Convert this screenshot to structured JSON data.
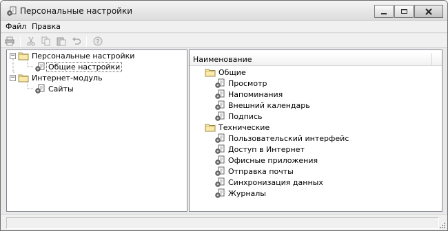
{
  "window": {
    "title": "Персональные настройки",
    "icon": "settings-app-icon",
    "controls": {
      "minimize": "minimize-icon",
      "maximize": "maximize-icon",
      "close": "close-icon"
    }
  },
  "menubar": {
    "items": [
      {
        "label": "Файл"
      },
      {
        "label": "Правка"
      }
    ]
  },
  "toolbar": {
    "buttons": [
      {
        "icon": "print-icon"
      },
      {
        "icon": "cut-icon"
      },
      {
        "icon": "copy-icon"
      },
      {
        "icon": "paste-icon"
      },
      {
        "icon": "undo-icon"
      },
      {
        "icon": "help-icon"
      }
    ]
  },
  "tree": {
    "nodes": [
      {
        "label": "Персональные настройки",
        "icon": "folder-icon",
        "expander": "−"
      },
      {
        "label": "Общие настройки",
        "icon": "settings-item-icon"
      },
      {
        "label": "Интернет-модуль",
        "icon": "folder-icon",
        "expander": "−"
      },
      {
        "label": "Сайты",
        "icon": "settings-item-icon"
      }
    ]
  },
  "list": {
    "column_header": "Наименование",
    "groups": [
      {
        "label": "Общие",
        "icon": "folder-icon",
        "items": [
          "Просмотр",
          "Напоминания",
          "Внешний календарь",
          "Подпись"
        ]
      },
      {
        "label": "Технические",
        "icon": "folder-icon",
        "items": [
          "Пользовательский интерфейс",
          "Доступ в Интернет",
          "Офисные приложения",
          "Отправка почты",
          "Синхронизация данных",
          "Журналы"
        ]
      }
    ]
  },
  "colors": {
    "window_bg": "#e9e9e9",
    "pane_border": "#828790",
    "folder": "#f2d27a"
  }
}
